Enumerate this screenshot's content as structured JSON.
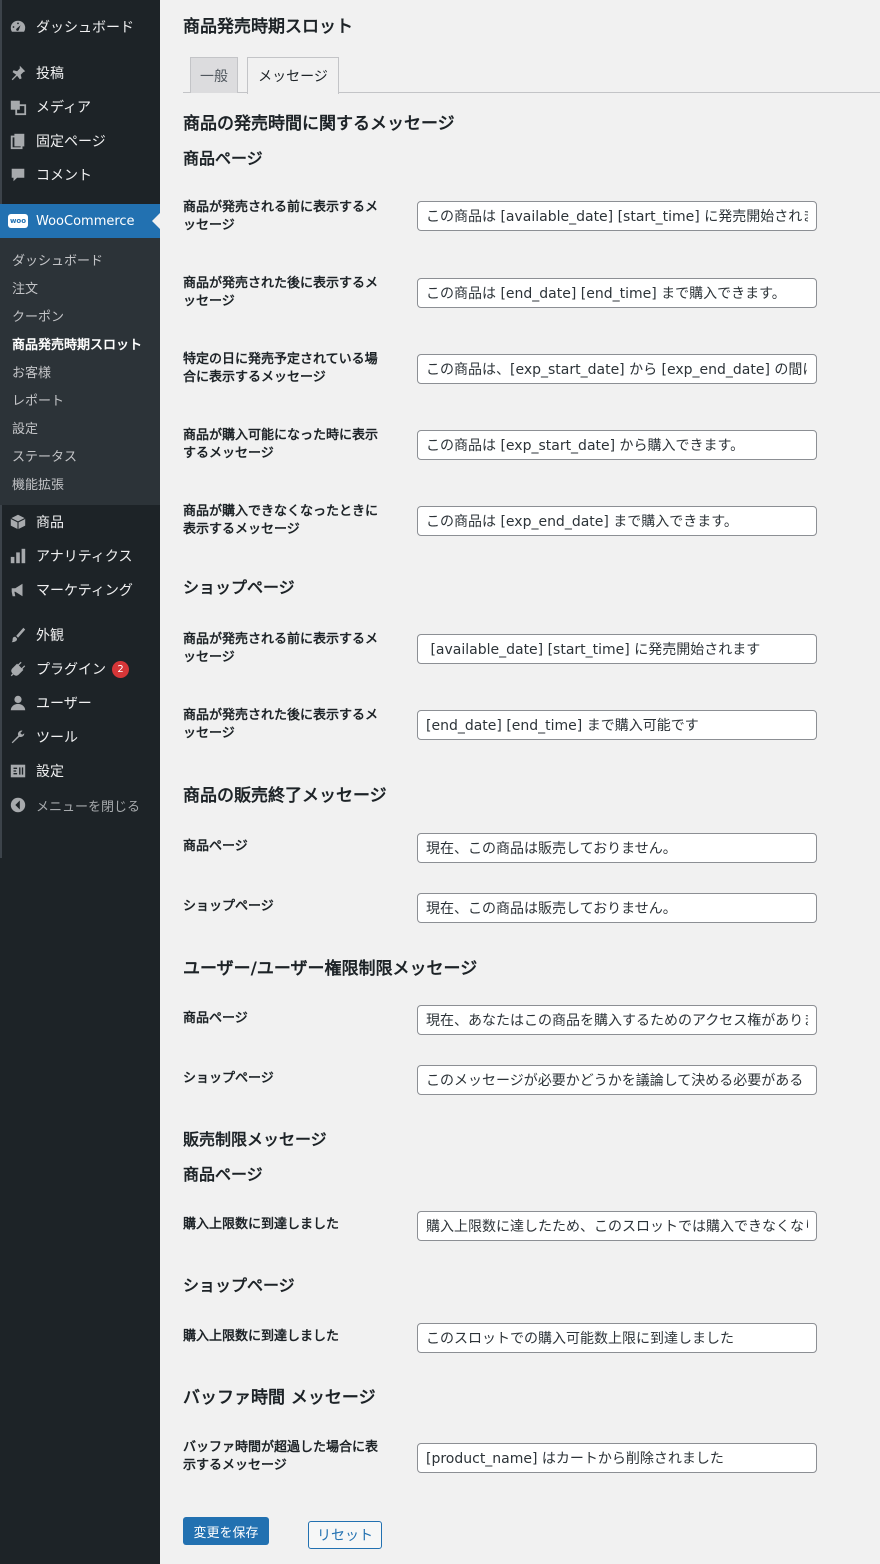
{
  "sidebar": {
    "top_items": [
      {
        "label": "ダッシュボード",
        "icon": "dashboard-icon"
      },
      {
        "label": "投稿",
        "icon": "pin-icon"
      },
      {
        "label": "メディア",
        "icon": "media-icon"
      },
      {
        "label": "固定ページ",
        "icon": "page-icon"
      },
      {
        "label": "コメント",
        "icon": "comment-icon"
      }
    ],
    "woocommerce": {
      "label": "WooCommerce",
      "icon_text": "woo"
    },
    "submenu": [
      "ダッシュボード",
      "注文",
      "クーポン",
      "商品発売時期スロット",
      "お客様",
      "レポート",
      "設定",
      "ステータス",
      "機能拡張"
    ],
    "lower_items": [
      {
        "label": "商品",
        "icon": "box-icon"
      },
      {
        "label": "アナリティクス",
        "icon": "bar-chart-icon"
      },
      {
        "label": "マーケティング",
        "icon": "megaphone-icon"
      }
    ],
    "bottom_items": [
      {
        "label": "外観",
        "icon": "brush-icon"
      },
      {
        "label": "プラグイン",
        "icon": "plugin-icon",
        "badge": "2"
      },
      {
        "label": "ユーザー",
        "icon": "user-icon"
      },
      {
        "label": "ツール",
        "icon": "wrench-icon"
      },
      {
        "label": "設定",
        "icon": "settings-icon"
      }
    ],
    "collapse_label": "メニューを閉じる"
  },
  "page": {
    "title": "商品発売時期スロット",
    "tabs": [
      "一般",
      "メッセージ"
    ],
    "section1_title": "商品の発売時間に関するメッセージ",
    "product_page": "商品ページ",
    "shop_page": "ショップページ",
    "product_rows": [
      {
        "label": "商品が発売される前に表示するメッセージ",
        "value": "この商品は [available_date] [start_time] に発売開始されます。"
      },
      {
        "label": "商品が発売された後に表示するメッセージ",
        "value": "この商品は [end_date] [end_time] まで購入できます。"
      },
      {
        "label": "特定の日に発売予定されている場合に表示するメッセージ",
        "value": "この商品は、[exp_start_date] から [exp_end_date] の間に購入"
      },
      {
        "label": "商品が購入可能になった時に表示するメッセージ",
        "value": "この商品は [exp_start_date] から購入できます。"
      },
      {
        "label": "商品が購入できなくなったときに表示するメッセージ",
        "value": "この商品は [exp_end_date] まで購入できます。"
      }
    ],
    "shop_rows": [
      {
        "label": "商品が発売される前に表示するメッセージ",
        "value": " [available_date] [start_time] に発売開始されます"
      },
      {
        "label": "商品が発売された後に表示するメッセージ",
        "value": "[end_date] [end_time] まで購入可能です"
      }
    ],
    "section2_title": "商品の販売終了メッセージ",
    "end_rows": [
      {
        "label": "商品ページ",
        "value": "現在、この商品は販売しておりません。"
      },
      {
        "label": "ショップページ",
        "value": "現在、この商品は販売しておりません。"
      }
    ],
    "section3_title": "ユーザー/ユーザー権限制限メッセージ",
    "user_rows": [
      {
        "label": "商品ページ",
        "value": "現在、あなたはこの商品を購入するためのアクセス権がありま"
      },
      {
        "label": "ショップページ",
        "value": "このメッセージが必要かどうかを議論して決める必要がある"
      }
    ],
    "section4_title": "販売制限メッセージ",
    "limit_product_row": {
      "label": "購入上限数に到達しました",
      "value": "購入上限数に達したため、このスロットでは購入できなくなり"
    },
    "limit_shop_row": {
      "label": "購入上限数に到達しました",
      "value": "このスロットでの購入可能数上限に到達しました"
    },
    "section5_title": "バッファ時間 メッセージ",
    "buffer_row": {
      "label": "バッファ時間が超過した場合に表示するメッセージ",
      "value": "[product_name] はカートから削除されました"
    },
    "save_label": "変更を保存",
    "reset_label": "リセット"
  },
  "colors": {
    "sidebar_bg": "#1d2327",
    "submenu_bg": "#2c3338",
    "accent": "#2271b1",
    "badge": "#d63638"
  }
}
